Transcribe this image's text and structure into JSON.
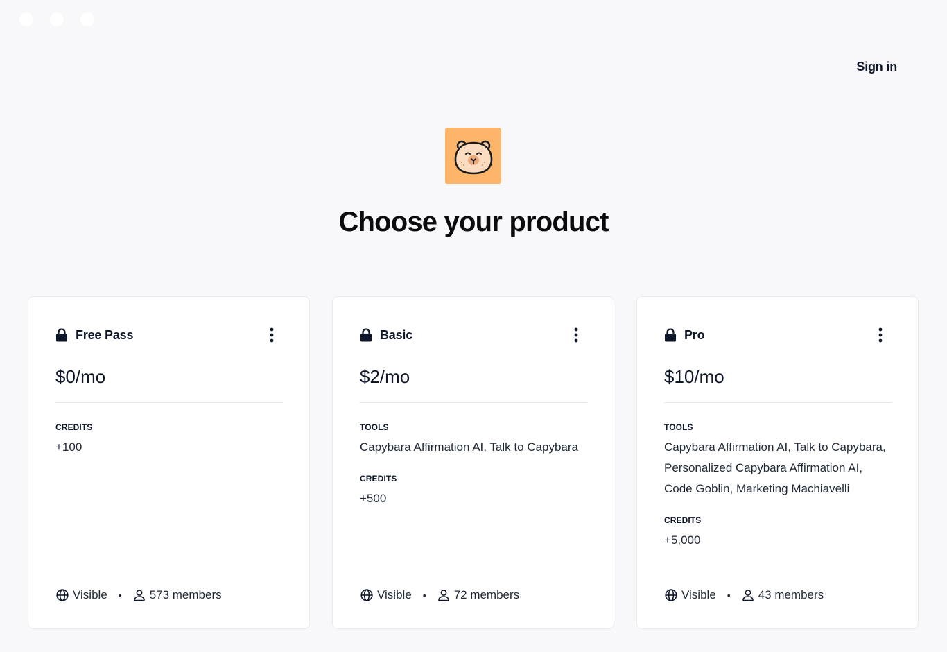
{
  "header": {
    "sign_in": "Sign in"
  },
  "logo": {
    "icon": "capybara-icon",
    "bg": "#fdb56a"
  },
  "page_title": "Choose your product",
  "cards": [
    {
      "name": "Free Pass",
      "price": "$0/mo",
      "sections": [
        {
          "label": "CREDITS",
          "value": "+100"
        }
      ],
      "visibility": "Visible",
      "members": "573 members"
    },
    {
      "name": "Basic",
      "price": "$2/mo",
      "sections": [
        {
          "label": "TOOLS",
          "value": "Capybara Affirmation AI, Talk to Capybara"
        },
        {
          "label": "CREDITS",
          "value": "+500"
        }
      ],
      "visibility": "Visible",
      "members": "72 members"
    },
    {
      "name": "Pro",
      "price": "$10/mo",
      "sections": [
        {
          "label": "TOOLS",
          "value": "Capybara Affirmation AI, Talk to Capybara, Personalized Capybara Affirmation AI, Code Goblin, Marketing Machiavelli"
        },
        {
          "label": "CREDITS",
          "value": "+5,000"
        }
      ],
      "visibility": "Visible",
      "members": "43 members"
    }
  ],
  "footer_separator": "•"
}
